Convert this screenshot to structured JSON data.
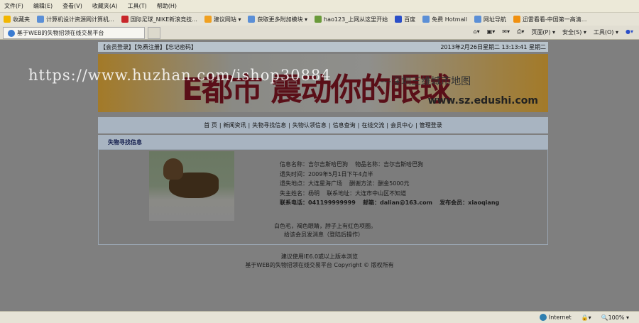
{
  "menubar": [
    "文件(F)",
    "编辑(E)",
    "查看(V)",
    "收藏夹(A)",
    "工具(T)",
    "帮助(H)"
  ],
  "favorites": {
    "label": "收藏夹",
    "items": [
      "计算机设计资源网计算机...",
      "国际足球_NIKE新浪竞技...",
      "建议网站 ▾",
      "获取更多附加模块 ▾",
      "hao123_上网从这里开始",
      "百度",
      "免费 Hotmail",
      "网址导航",
      "迅雷看看-中国第一高清..."
    ]
  },
  "tab": {
    "title": "基于WEB的失物招领在线交易平台"
  },
  "commandbar": [
    "页面(P) ▾",
    "安全(S) ▾",
    "工具(O) ▾"
  ],
  "topbar": {
    "links": "【会员登录】【免费注册】【忘记密码】",
    "datetime": "2013年2月26日星期二 13:13:41 星期二"
  },
  "banner": {
    "headline": "E都市 震动你的眼球",
    "subtitle": "---深圳三维城市地图",
    "url": "www.sz.edushi.com"
  },
  "watermark": "https://www.huzhan.com/ishop30884",
  "nav": [
    "首 页",
    "新闻资讯",
    "失物寻找信息",
    "失物认领信息",
    "信息查询",
    "在线交流",
    "会员中心",
    "管理登录"
  ],
  "section": {
    "title": "失物寻找信息"
  },
  "detail": {
    "info_name": "信息名称：吉尔吉斯哈巴狗",
    "item_name": "物品名称：吉尔吉斯哈巴狗",
    "lost_time": "遗失时间：2009年5月1日下午4点半",
    "lost_place": "遗失地点：大连星海广场",
    "reward": "酬谢方法：酬金5000元",
    "owner": "失主姓名：杨明",
    "address": "联系地址：大连市中山区不知道",
    "phone": "联系电话：041199999999",
    "email": "邮箱：dalian@163.com",
    "member": "发布会员：xiaoqiang",
    "description": "白色毛，褐色眼睛，脖子上有红色项圈。",
    "message_link": "给该会员发消息（登陆后操作）"
  },
  "footer": {
    "line1": "建议使用IE6.0或以上版本浏览",
    "line2": "基于WEB的失物招领在线交易平台 Copyright © 版权所有"
  },
  "status": {
    "zone": "Internet",
    "zoom": "100%"
  }
}
